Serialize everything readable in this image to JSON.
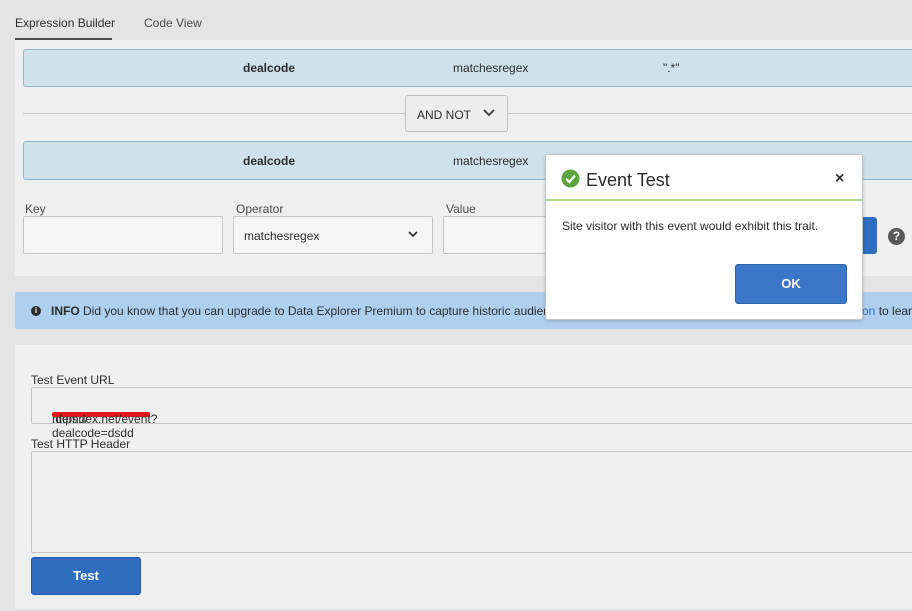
{
  "tabs": [
    {
      "label": "Expression Builder",
      "active": true
    },
    {
      "label": "Code View",
      "active": false
    }
  ],
  "rules": [
    {
      "key": "dealcode",
      "operator": "matchesregex",
      "value": "\".*\""
    },
    {
      "key": "dealcode",
      "operator": "matchesregex",
      "value": ""
    }
  ],
  "conjunction": {
    "selected": "AND NOT"
  },
  "new_rule": {
    "key_label": "Key",
    "operator_label": "Operator",
    "operator_value": "matchesregex",
    "value_label": "Value"
  },
  "help_icon": {
    "glyph": "?"
  },
  "info_banner": {
    "badge": "INFO",
    "text": "Did you know that you can upgrade to Data Explorer Premium to capture historic audien",
    "link_fragment": "on",
    "tail": "to lear",
    "color": "#aed0ee"
  },
  "test": {
    "url_label": "Test Event URL",
    "url_prefix": "https://",
    "url_suffix": ".demdex.net/event?dealcode=dsdd",
    "header_label": "Test HTTP Header",
    "button_label": "Test"
  },
  "modal": {
    "title": "Event Test",
    "message": "Site visitor with this event would exhibit this trait.",
    "ok_label": "OK",
    "close_glyph": "×",
    "icon": "check-circle-icon",
    "success_color": "#5ba53c"
  },
  "colors": {
    "primary": "#2f6ebf",
    "rule_bg": "#cfe1eb"
  }
}
